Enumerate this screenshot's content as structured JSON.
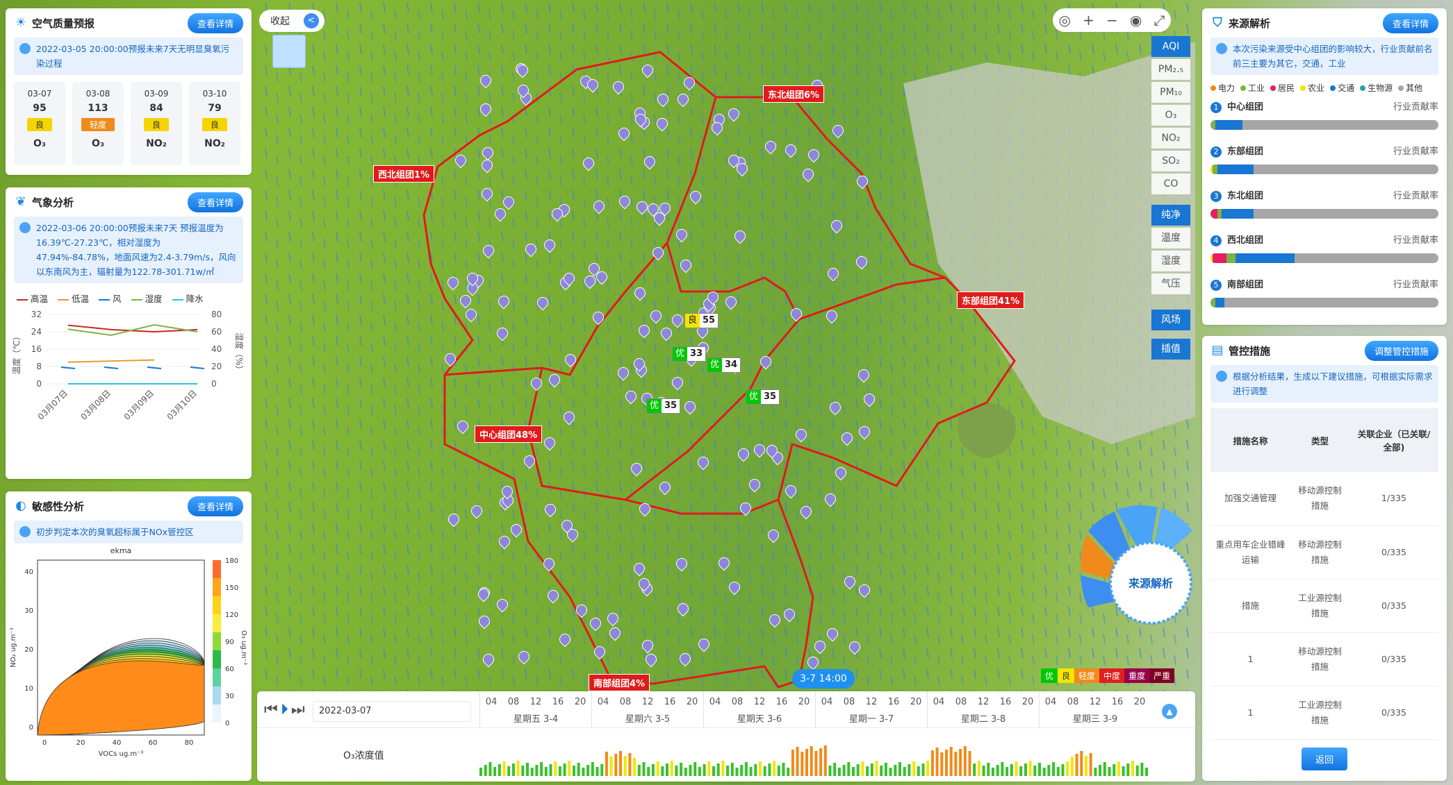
{
  "aq": {
    "title": "空气质量预报",
    "btn": "查看详情",
    "note": "2022-03-05 20:00:00预报未来7天无明显臭氧污染过程",
    "days": [
      {
        "d": "03-07",
        "v": "95",
        "lv": "良",
        "c": "#f5d500",
        "p": "O₃"
      },
      {
        "d": "03-08",
        "v": "113",
        "lv": "轻度",
        "c": "#f08a1a",
        "p": "O₃"
      },
      {
        "d": "03-09",
        "v": "84",
        "lv": "良",
        "c": "#f5d500",
        "p": "NO₂"
      },
      {
        "d": "03-10",
        "v": "79",
        "lv": "良",
        "c": "#f5d500",
        "p": "NO₂"
      }
    ]
  },
  "met": {
    "title": "气象分析",
    "btn": "查看详情",
    "note": "2022-03-06 20:00:00预报未来7天  预报温度为16.39℃-27.23℃，相对湿度为47.94%-84.78%，地面风速为2.4-3.79m/s，风向以东南风为主，辐射量为122.78-301.71w/㎡",
    "legend": [
      "高温",
      "低温",
      "风",
      "湿度",
      "降水"
    ],
    "legend_colors": [
      "#c62828",
      "#e39b2b",
      "#1976d2",
      "#7cb342",
      "#26c6da"
    ],
    "ylabel_left": "温度（℃）",
    "ylabel_right": "湿度（%）",
    "yticks_left": [
      "32",
      "24",
      "16",
      "8",
      "0"
    ],
    "yticks_right": [
      "80",
      "60",
      "40",
      "20",
      "0"
    ],
    "x": [
      "03月07日",
      "03月08日",
      "03月09日",
      "03月10日"
    ],
    "high": [
      27,
      25,
      24,
      25
    ],
    "low": [
      10,
      10.5,
      11,
      null
    ],
    "humidity": [
      63,
      56,
      68,
      60
    ],
    "rain": [
      0,
      0,
      0,
      0
    ]
  },
  "sens": {
    "title": "敏感性分析",
    "btn": "查看详情",
    "note": "初步判定本次的臭氧超标属于NOx管控区",
    "plot_title": "ekma",
    "xlabel": "VOCs ug.m⁻³",
    "ylabel": "NO₂ ug.m⁻³",
    "cbar_label": "O₃ ug.m⁻³",
    "xticks": [
      "0",
      "20",
      "40",
      "60",
      "80"
    ],
    "yticks": [
      "40",
      "30",
      "20",
      "10",
      "0"
    ],
    "cticks": [
      "180",
      "150",
      "120",
      "90",
      "60",
      "30",
      "0"
    ]
  },
  "map": {
    "collapse": "收起",
    "layers": [
      "AQI",
      "PM₂.₅",
      "PM₁₀",
      "O₃",
      "NO₂",
      "SO₂",
      "CO"
    ],
    "met_layers": [
      "纯净",
      "温度",
      "湿度",
      "气压"
    ],
    "wind": "风场",
    "interp": "插值",
    "regions": [
      {
        "n": "东北组团6%"
      },
      {
        "n": "西北组团1%"
      },
      {
        "n": "东部组团41%"
      },
      {
        "n": "中心组团48%"
      },
      {
        "n": "南部组团4%"
      }
    ],
    "aqi": [
      {
        "l": "良",
        "v": "55"
      },
      {
        "l": "优",
        "v": "33"
      },
      {
        "l": "优",
        "v": "34"
      },
      {
        "l": "优",
        "v": "35"
      },
      {
        "l": "优",
        "v": "35"
      }
    ],
    "levels": [
      "优",
      "良",
      "轻度",
      "中度",
      "重度",
      "严重"
    ],
    "level_colors": [
      "#00c800",
      "#f5e400",
      "#f08a1a",
      "#e02020",
      "#99004c",
      "#7e0023"
    ],
    "wheel": "来源解析",
    "time": "3-7 14:00"
  },
  "timeline": {
    "date": "2022-03-07",
    "hours": [
      "04",
      "08",
      "12",
      "16",
      "20"
    ],
    "days": [
      "星期五 3-4",
      "星期六 3-5",
      "星期天 3-6",
      "星期一 3-7",
      "星期二 3-8",
      "星期三 3-9"
    ],
    "series": "O₃浓度值"
  },
  "src": {
    "title": "来源解析",
    "btn": "查看详情",
    "note": "本次污染来源受中心组团的影响较大，行业贡献前名前三主要为其它，交通，工业",
    "cats": [
      "电力",
      "工业",
      "居民",
      "农业",
      "交通",
      "生物源",
      "其他"
    ],
    "cat_colors": [
      "#f08a1a",
      "#7cb342",
      "#e91e63",
      "#f5e400",
      "#1976d2",
      "#26a69a",
      "#a6a6a6"
    ],
    "rows": [
      {
        "i": "1",
        "n": "中心组团",
        "r": "行业贡献率"
      },
      {
        "i": "2",
        "n": "东部组团",
        "r": "行业贡献率"
      },
      {
        "i": "3",
        "n": "东北组团",
        "r": "行业贡献率"
      },
      {
        "i": "4",
        "n": "西北组团",
        "r": "行业贡献率"
      },
      {
        "i": "5",
        "n": "南部组团",
        "r": "行业贡献率"
      }
    ]
  },
  "ctrl": {
    "title": "管控措施",
    "btn": "调整管控措施",
    "note": "根据分析结果，生成以下建议措施，可根据实际需求进行调整",
    "th": [
      "措施名称",
      "类型",
      "关联企业（已关联/全部)"
    ],
    "rows": [
      [
        "加强交通管理",
        "移动源控制措施",
        "1/335"
      ],
      [
        "重点用车企业错峰运输",
        "移动源控制措施",
        "0/335"
      ],
      [
        "措施",
        "工业源控制措施",
        "0/335"
      ],
      [
        "1",
        "移动源控制措施",
        "0/335"
      ],
      [
        "1",
        "工业源控制措施",
        "0/335"
      ]
    ],
    "back": "返回"
  }
}
